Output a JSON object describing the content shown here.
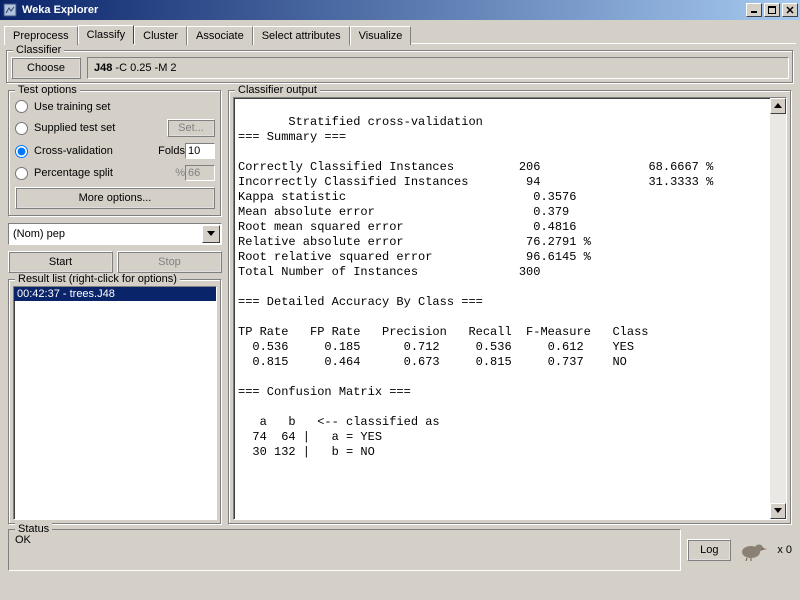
{
  "window": {
    "title": "Weka Explorer"
  },
  "tabs": [
    "Preprocess",
    "Classify",
    "Cluster",
    "Associate",
    "Select attributes",
    "Visualize"
  ],
  "active_tab": 1,
  "classifier": {
    "legend": "Classifier",
    "choose_label": "Choose",
    "name": "J48",
    "args": " -C 0.25 -M 2"
  },
  "test_options": {
    "legend": "Test options",
    "use_training": "Use training set",
    "supplied": "Supplied test set",
    "set_btn": "Set...",
    "cross_val": "Cross-validation",
    "folds_label": "Folds",
    "folds_value": "10",
    "perc_split": "Percentage split",
    "perc_label": "%",
    "perc_value": "66",
    "more_options": "More options...",
    "selected": "cross"
  },
  "class_combo": "(Nom) pep",
  "start_label": "Start",
  "stop_label": "Stop",
  "result_list": {
    "legend": "Result list (right-click for options)",
    "items": [
      "00:42:37 - trees.J48"
    ]
  },
  "output": {
    "legend": "Classifier output",
    "lines": [
      "       Stratified cross-validation",
      "=== Summary ===",
      "",
      "Correctly Classified Instances         206               68.6667 %",
      "Incorrectly Classified Instances        94               31.3333 %",
      "Kappa statistic                          0.3576",
      "Mean absolute error                      0.379 ",
      "Root mean squared error                  0.4816",
      "Relative absolute error                 76.2791 %",
      "Root relative squared error             96.6145 %",
      "Total Number of Instances              300     ",
      "",
      "=== Detailed Accuracy By Class ===",
      "",
      "TP Rate   FP Rate   Precision   Recall  F-Measure   Class",
      "  0.536     0.185      0.712     0.536     0.612    YES",
      "  0.815     0.464      0.673     0.815     0.737    NO",
      "",
      "=== Confusion Matrix ===",
      "",
      "   a   b   <-- classified as",
      "  74  64 |   a = YES",
      "  30 132 |   b = NO",
      ""
    ]
  },
  "chart_data": {
    "type": "table",
    "summary": {
      "correct": {
        "count": 206,
        "pct": 68.6667
      },
      "incorrect": {
        "count": 94,
        "pct": 31.3333
      },
      "kappa": 0.3576,
      "mae": 0.379,
      "rmse": 0.4816,
      "rae_pct": 76.2791,
      "rrse_pct": 96.6145,
      "total_instances": 300
    },
    "accuracy_by_class": {
      "columns": [
        "TP Rate",
        "FP Rate",
        "Precision",
        "Recall",
        "F-Measure",
        "Class"
      ],
      "rows": [
        [
          0.536,
          0.185,
          0.712,
          0.536,
          0.612,
          "YES"
        ],
        [
          0.815,
          0.464,
          0.673,
          0.815,
          0.737,
          "NO"
        ]
      ]
    },
    "confusion_matrix": {
      "labels": [
        "YES",
        "NO"
      ],
      "matrix": [
        [
          74,
          64
        ],
        [
          30,
          132
        ]
      ]
    }
  },
  "status": {
    "legend": "Status",
    "text": "OK",
    "log_label": "Log",
    "task_count": "x 0"
  }
}
